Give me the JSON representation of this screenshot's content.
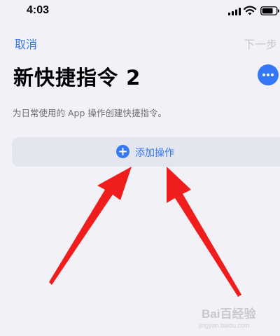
{
  "status_bar": {
    "time": "4:03"
  },
  "nav": {
    "cancel_label": "取消",
    "next_label": "下一步"
  },
  "page": {
    "title": "新快捷指令 2",
    "subtitle": "为日常使用的 App 操作创建快捷指令。"
  },
  "add_action": {
    "label": "添加操作"
  },
  "icons": {
    "more": "ellipsis-icon",
    "add": "plus-circle-icon",
    "signal": "cellular-signal-icon",
    "wifi": "wifi-icon",
    "battery": "battery-icon"
  },
  "colors": {
    "accent": "#3478f6",
    "background": "#f2f1f7",
    "disabled": "#c6c6cb",
    "annotation_arrow": "#f01d1d"
  },
  "watermark": {
    "text": "Bai百经验",
    "url_text": "jingyan.baidu.com"
  }
}
